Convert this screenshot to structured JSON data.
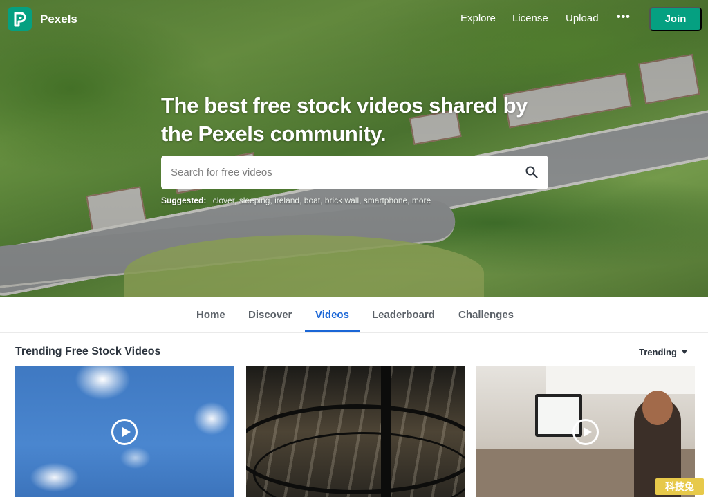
{
  "header": {
    "brand": "Pexels",
    "nav": [
      "Explore",
      "License",
      "Upload"
    ],
    "more": "•••",
    "join_label": "Join"
  },
  "hero": {
    "headline": "The best free stock videos shared by the Pexels community.",
    "search_placeholder": "Search for free videos",
    "suggested_label": "Suggested:",
    "suggested_tags": "clover, sleeping, ireland, boat, brick wall, smartphone, more"
  },
  "tabs": [
    "Home",
    "Discover",
    "Videos",
    "Leaderboard",
    "Challenges"
  ],
  "active_tab": "Videos",
  "section": {
    "title": "Trending Free Stock Videos",
    "sort_label": "Trending"
  },
  "watermark": "科技兔",
  "colors": {
    "brand": "#05a081",
    "active_tab": "#1a66d6"
  }
}
